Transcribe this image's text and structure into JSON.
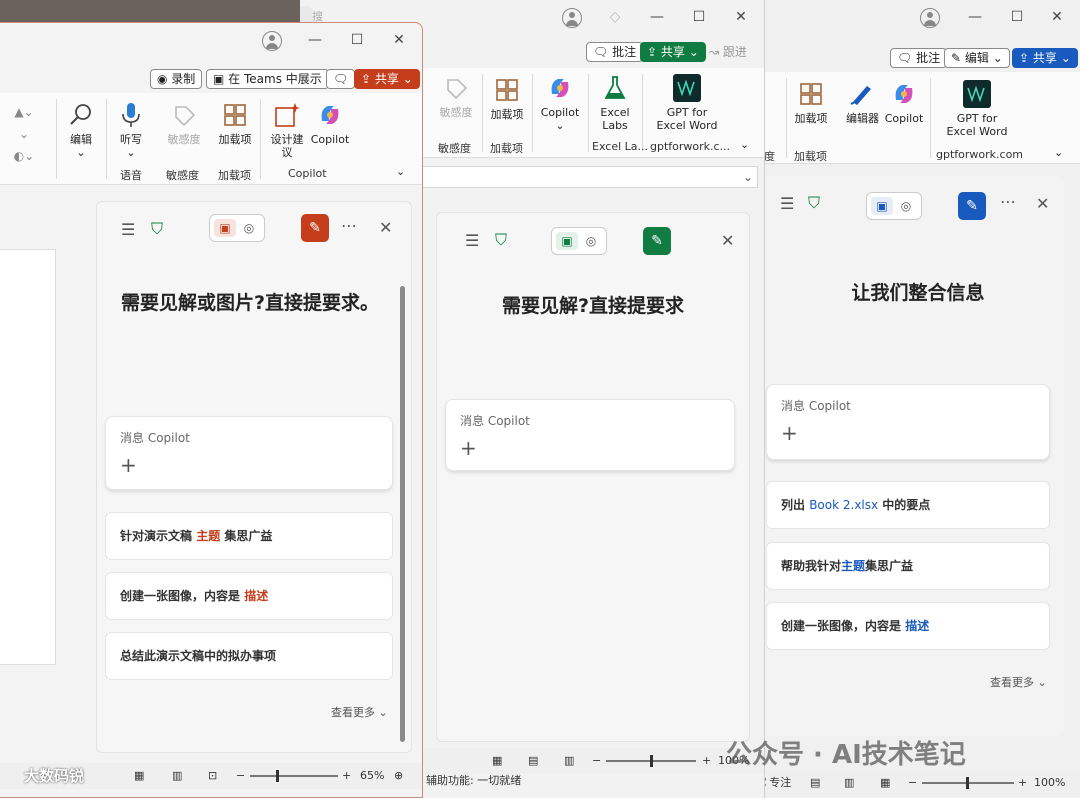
{
  "watermark": "公众号 · AI技术笔记",
  "bottom_mark": "大数码锐",
  "search_placeholder": "搜索",
  "ppt": {
    "ribbon_bar": {
      "record": "录制",
      "teams": "在 Teams 中展示",
      "share": "共享"
    },
    "ribbon": {
      "edit": "编辑",
      "dictate": "听写",
      "sensitivity": "敏感度",
      "addins": "加载项",
      "designer": "设计建议",
      "copilot": "Copilot",
      "groups": {
        "voice": "语音",
        "sensitivity": "敏感度",
        "addins": "加载项",
        "copilot": "Copilot"
      }
    },
    "pane": {
      "headline": "需要见解或图片?直接提要求。",
      "placeholder": "消息 Copilot",
      "suggestions": [
        {
          "pre": "针对演示文稿 ",
          "kw": "主题",
          "post": " 集思广益"
        },
        {
          "pre": "创建一张图像，内容是 ",
          "kw": "描述",
          "post": ""
        },
        {
          "pre": "总结此演示文稿中的拟办事项",
          "kw": "",
          "post": ""
        }
      ],
      "see_more": "查看更多"
    },
    "status": {
      "zoom": "65%"
    },
    "accent": "#c43e1c"
  },
  "excel": {
    "ribbon_bar": {
      "comments": "批注",
      "share": "共享",
      "catchup": "跟进"
    },
    "ribbon": {
      "sensitivity": "敏感度",
      "addins": "加载项",
      "copilot": "Copilot",
      "excel_labs": "Excel Labs",
      "gpt": "GPT for Excel Word",
      "groups": {
        "sensitivity": "敏感度",
        "addins": "加载项",
        "excel_labs": "Excel La...",
        "gpt": "gptforwork.c..."
      }
    },
    "pane": {
      "headline": "需要见解?直接提要求",
      "placeholder": "消息 Copilot"
    },
    "status": {
      "accessibility": "辅助功能: 一切就绪",
      "zoom": "100%"
    },
    "accent": "#107c41"
  },
  "word": {
    "ribbon_bar": {
      "comments": "批注",
      "edit": "编辑",
      "share": "共享"
    },
    "ribbon": {
      "sensitivity": "度",
      "addins": "加载项",
      "editor": "编辑器",
      "copilot": "Copilot",
      "gpt": "GPT for Excel Word",
      "groups": {
        "addins": "加载项",
        "gpt": "gptforwork.com"
      }
    },
    "pane": {
      "headline": "让我们整合信息",
      "placeholder": "消息 Copilot",
      "suggestions": [
        {
          "pre": "列出 ",
          "kw": "Book 2.xlsx",
          "post": " 中的要点"
        },
        {
          "pre": "帮助我针对",
          "kw": "主题",
          "post": "集思广益"
        },
        {
          "pre": "创建一张图像，内容是 ",
          "kw": "描述",
          "post": ""
        }
      ],
      "see_more": "查看更多"
    },
    "status": {
      "focus": "专注",
      "zoom": "100%"
    },
    "accent": "#185abd"
  }
}
